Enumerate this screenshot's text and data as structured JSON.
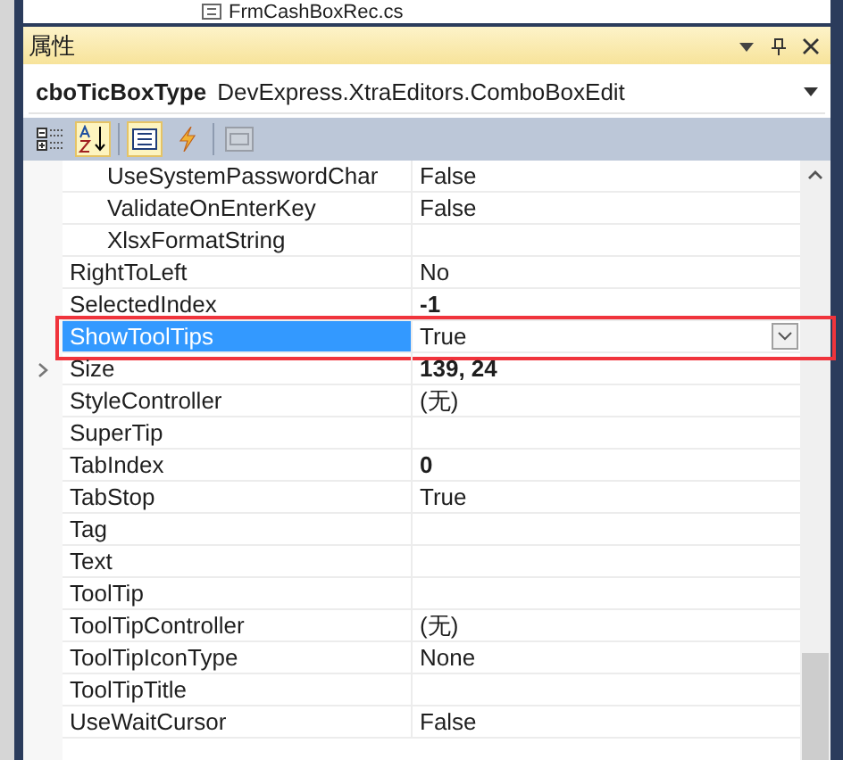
{
  "tree_item": {
    "label": "FrmCashBoxRec.cs"
  },
  "panel": {
    "title": "属性"
  },
  "object_selector": {
    "name": "cboTicBoxType",
    "type": "DevExpress.XtraEditors.ComboBoxEdit"
  },
  "toolbar": [
    {
      "kind": "categorized",
      "selected": false,
      "disabled": false
    },
    {
      "kind": "alphabetical",
      "selected": true,
      "disabled": false
    },
    {
      "kind": "properties",
      "selected": true,
      "disabled": false
    },
    {
      "kind": "events",
      "selected": false,
      "disabled": false
    },
    {
      "kind": "pages",
      "selected": false,
      "disabled": true
    }
  ],
  "rows": [
    {
      "name": "UseSystemPasswordChar",
      "value": "False",
      "indented": true,
      "selected": false
    },
    {
      "name": "ValidateOnEnterKey",
      "value": "False",
      "indented": true,
      "selected": false
    },
    {
      "name": "XlsxFormatString",
      "value": "",
      "indented": true,
      "selected": false
    },
    {
      "name": "RightToLeft",
      "value": "No",
      "selected": false
    },
    {
      "name": "SelectedIndex",
      "value": "-1",
      "bold": true,
      "selected": false
    },
    {
      "name": "ShowToolTips",
      "value": "True",
      "selected": true,
      "annotated": true
    },
    {
      "name": "Size",
      "value": "139, 24",
      "bold": true,
      "expandable": true,
      "selected": false
    },
    {
      "name": "StyleController",
      "value": "(无)",
      "selected": false
    },
    {
      "name": "SuperTip",
      "value": "",
      "selected": false
    },
    {
      "name": "TabIndex",
      "value": "0",
      "bold": true,
      "selected": false
    },
    {
      "name": "TabStop",
      "value": "True",
      "selected": false
    },
    {
      "name": "Tag",
      "value": "",
      "selected": false
    },
    {
      "name": "Text",
      "value": "",
      "selected": false
    },
    {
      "name": "ToolTip",
      "value": "",
      "selected": false
    },
    {
      "name": "ToolTipController",
      "value": "(无)",
      "selected": false
    },
    {
      "name": "ToolTipIconType",
      "value": "None",
      "selected": false
    },
    {
      "name": "ToolTipTitle",
      "value": "",
      "selected": false
    },
    {
      "name": "UseWaitCursor",
      "value": "False",
      "selected": false
    }
  ]
}
